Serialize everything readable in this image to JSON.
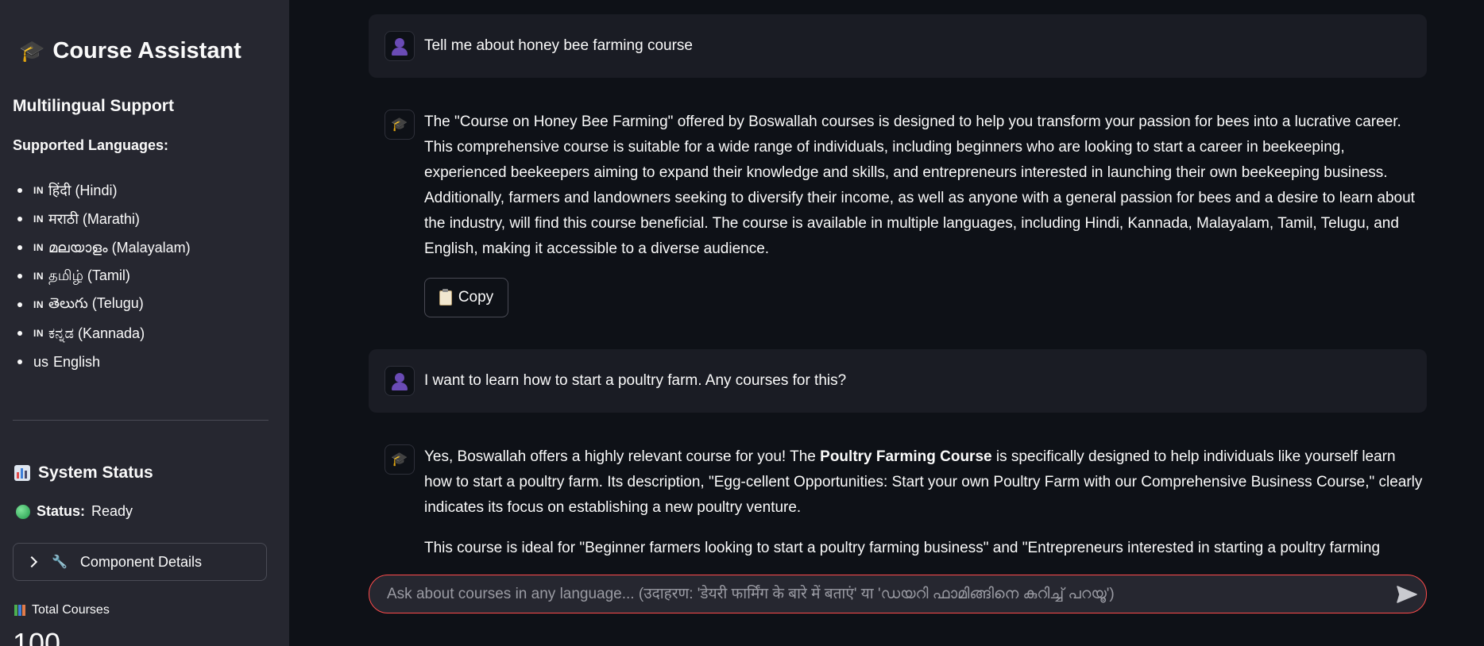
{
  "sidebar": {
    "title": "Course Assistant",
    "title_icon": "graduation-cap-icon",
    "section_heading": "Multilingual Support",
    "languages_heading": "Supported Languages:",
    "languages": [
      {
        "flag": "IN",
        "label": "हिंदी (Hindi)"
      },
      {
        "flag": "IN",
        "label": "मराठी (Marathi)"
      },
      {
        "flag": "IN",
        "label": "മലയാളം (Malayalam)"
      },
      {
        "flag": "IN",
        "label": "தமிழ் (Tamil)"
      },
      {
        "flag": "IN",
        "label": "తెలుగు (Telugu)"
      },
      {
        "flag": "IN",
        "label": "ಕನ್ನಡ (Kannada)"
      },
      {
        "flag": "US",
        "label": "English"
      }
    ],
    "system_status_heading": "System Status",
    "status_label": "Status:",
    "status_value": "Ready",
    "component_details_label": "Component Details",
    "metric_label": "Total Courses",
    "metric_value": "100"
  },
  "chat": {
    "messages": [
      {
        "role": "user",
        "text": "Tell me about honey bee farming course"
      },
      {
        "role": "assistant",
        "text": "The \"Course on Honey Bee Farming\" offered by Boswallah courses is designed to help you transform your passion for bees into a lucrative career. This comprehensive course is suitable for a wide range of individuals, including beginners who are looking to start a career in beekeeping, experienced beekeepers aiming to expand their knowledge and skills, and entrepreneurs interested in launching their own beekeeping business. Additionally, farmers and landowners seeking to diversify their income, as well as anyone with a general passion for bees and a desire to learn about the industry, will find this course beneficial. The course is available in multiple languages, including Hindi, Kannada, Malayalam, Tamil, Telugu, and English, making it accessible to a diverse audience.",
        "copy_label": "Copy"
      },
      {
        "role": "user",
        "text": "I want to learn how to start a poultry farm. Any courses for this?"
      },
      {
        "role": "assistant",
        "text_before": "Yes, Boswallah offers a highly relevant course for you! The ",
        "text_bold": "Poultry Farming Course",
        "text_after": " is specifically designed to help individuals like yourself learn how to start a poultry farm. Its description, \"Egg-cellent Opportunities: Start your own Poultry Farm with our Comprehensive Business Course,\" clearly indicates its focus on establishing a new poultry venture.",
        "text_para2": "This course is ideal for \"Beginner farmers looking to start a poultry farming business\" and \"Entrepreneurs interested in starting a poultry farming"
      }
    ]
  },
  "input": {
    "placeholder": "Ask about courses in any language... (उदाहरण: 'डेयरी फार्मिंग के बारे में बताएं' या 'ഡയറി ഫാമിങ്ങിനെ കുറിച്ച് പറയൂ')"
  },
  "colors": {
    "sidebar_bg": "#262730",
    "main_bg": "#0e1117",
    "accent": "#ff4b4b",
    "status_green": "#21c354"
  }
}
